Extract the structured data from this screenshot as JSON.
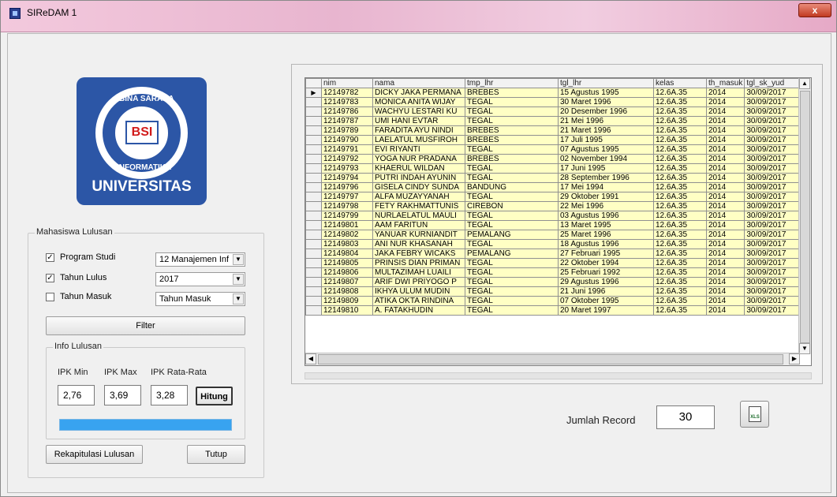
{
  "window": {
    "title": "SIReDAM 1",
    "close_label": "x"
  },
  "logo": {
    "ring_top": "BINA SARANA",
    "ring_bottom": "INFORMATIKA",
    "center": "BSI",
    "word": "UNIVERSITAS"
  },
  "group_lulusan": {
    "caption": "Mahasiswa Lulusan",
    "program_studi": {
      "label": "Program Studi",
      "checked": true,
      "value": "12  Manajemen Inf"
    },
    "tahun_lulus": {
      "label": "Tahun Lulus",
      "checked": true,
      "value": "2017"
    },
    "tahun_masuk": {
      "label": "Tahun Masuk",
      "checked": false,
      "value": "Tahun Masuk"
    },
    "filter_label": "Filter"
  },
  "group_info": {
    "caption": "Info Lulusan",
    "ipk_min_label": "IPK Min",
    "ipk_max_label": "IPK Max",
    "ipk_avg_label": "IPK Rata-Rata",
    "ipk_min": "2,76",
    "ipk_max": "3,69",
    "ipk_avg": "3,28",
    "hitung_label": "Hitung",
    "progress": 1.0
  },
  "buttons": {
    "rekap_label": "Rekapitulasi Lulusan",
    "tutup_label": "Tutup"
  },
  "jumlah": {
    "label": "Jumlah Record",
    "value": "30"
  },
  "excel": {
    "icon": "excel-export-icon",
    "icon_text": "XLS"
  },
  "grid": {
    "columns": [
      "nim",
      "nama",
      "tmp_lhr",
      "tgl_lhr",
      "kelas",
      "th_masuk",
      "tgl_sk_yud"
    ],
    "rows": [
      [
        "12149782",
        "DICKY JAKA PERMANA",
        "BREBES",
        "15 Agustus 1995",
        "12.6A.35",
        "2014",
        "30/09/2017"
      ],
      [
        "12149783",
        "MONICA ANITA WIJAY",
        "TEGAL",
        "30 Maret 1996",
        "12.6A.35",
        "2014",
        "30/09/2017"
      ],
      [
        "12149786",
        "WACHYU LESTARI KU",
        "TEGAL",
        "20 Desember 1996",
        "12.6A.35",
        "2014",
        "30/09/2017"
      ],
      [
        "12149787",
        "UMI HANI EVTAR",
        "TEGAL",
        "21 Mei 1996",
        "12.6A.35",
        "2014",
        "30/09/2017"
      ],
      [
        "12149789",
        "FARADITA AYU NINDI",
        "BREBES",
        "21 Maret 1996",
        "12.6A.35",
        "2014",
        "30/09/2017"
      ],
      [
        "12149790",
        "LAELATUL MUSFIROH",
        "BREBES",
        "17 Juli 1995",
        "12.6A.35",
        "2014",
        "30/09/2017"
      ],
      [
        "12149791",
        "EVI RIYANTI",
        "TEGAL",
        "07 Agustus 1995",
        "12.6A.35",
        "2014",
        "30/09/2017"
      ],
      [
        "12149792",
        "YOGA NUR PRADANA",
        "BREBES",
        "02 November 1994",
        "12.6A.35",
        "2014",
        "30/09/2017"
      ],
      [
        "12149793",
        "KHAERUL WILDAN",
        "TEGAL",
        "17 Juni 1995",
        "12.6A.35",
        "2014",
        "30/09/2017"
      ],
      [
        "12149794",
        "PUTRI INDAH AYUNIN",
        "TEGAL",
        "28 September 1996",
        "12.6A.35",
        "2014",
        "30/09/2017"
      ],
      [
        "12149796",
        "GISELA CINDY SUNDA",
        "BANDUNG",
        "17 Mei 1994",
        "12.6A.35",
        "2014",
        "30/09/2017"
      ],
      [
        "12149797",
        "ALFA MUZAYYANAH",
        "TEGAL",
        "29 Oktober 1991",
        "12.6A.35",
        "2014",
        "30/09/2017"
      ],
      [
        "12149798",
        "FETY RAKHMATTUNIS",
        "CIREBON",
        "22 Mei 1996",
        "12.6A.35",
        "2014",
        "30/09/2017"
      ],
      [
        "12149799",
        "NURLAELATUL MAULI",
        "TEGAL",
        "03 Agustus 1996",
        "12.6A.35",
        "2014",
        "30/09/2017"
      ],
      [
        "12149801",
        "AAM FARITUN",
        "TEGAL",
        "13 Maret 1995",
        "12.6A.35",
        "2014",
        "30/09/2017"
      ],
      [
        "12149802",
        "YANUAR KURNIANDIT",
        "PEMALANG",
        "25 Maret 1996",
        "12.6A.35",
        "2014",
        "30/09/2017"
      ],
      [
        "12149803",
        "ANI NUR KHASANAH",
        "TEGAL",
        "18 Agustus 1996",
        "12.6A.35",
        "2014",
        "30/09/2017"
      ],
      [
        "12149804",
        "JAKA FEBRY WICAKS",
        "PEMALANG",
        "27 Februari 1995",
        "12.6A.35",
        "2014",
        "30/09/2017"
      ],
      [
        "12149805",
        "PRINSIS DIAN PRIMAN",
        "TEGAL",
        "22 Oktober 1994",
        "12.6A.35",
        "2014",
        "30/09/2017"
      ],
      [
        "12149806",
        "MULTAZIMAH LUAILI",
        "TEGAL",
        "25 Februari 1992",
        "12.6A.35",
        "2014",
        "30/09/2017"
      ],
      [
        "12149807",
        "ARIF DWI PRIYOGO P",
        "TEGAL",
        "29 Agustus 1996",
        "12.6A.35",
        "2014",
        "30/09/2017"
      ],
      [
        "12149808",
        "IKHYA ULUM MUDIN",
        "TEGAL",
        "21 Juni 1996",
        "12.6A.35",
        "2014",
        "30/09/2017"
      ],
      [
        "12149809",
        "ATIKA OKTA RINDINA",
        "TEGAL",
        "07 Oktober 1995",
        "12.6A.35",
        "2014",
        "30/09/2017"
      ],
      [
        "12149810",
        "A. FATAKHUDIN",
        "TEGAL",
        "20 Maret 1997",
        "12.6A.35",
        "2014",
        "30/09/2017"
      ]
    ]
  }
}
